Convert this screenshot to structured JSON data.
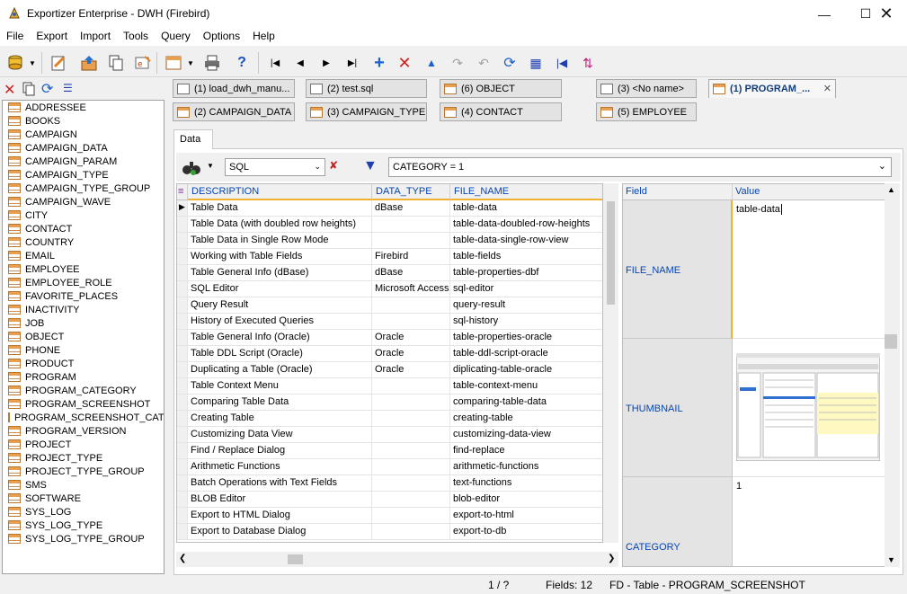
{
  "window": {
    "title": "Exportizer Enterprise - DWH (Firebird)"
  },
  "menu": [
    "File",
    "Export",
    "Import",
    "Tools",
    "Query",
    "Options",
    "Help"
  ],
  "tables": [
    "ADDRESSEE",
    "BOOKS",
    "CAMPAIGN",
    "CAMPAIGN_DATA",
    "CAMPAIGN_PARAM",
    "CAMPAIGN_TYPE",
    "CAMPAIGN_TYPE_GROUP",
    "CAMPAIGN_WAVE",
    "CITY",
    "CONTACT",
    "COUNTRY",
    "EMAIL",
    "EMPLOYEE",
    "EMPLOYEE_ROLE",
    "FAVORITE_PLACES",
    "INACTIVITY",
    "JOB",
    "OBJECT",
    "PHONE",
    "PRODUCT",
    "PROGRAM",
    "PROGRAM_CATEGORY",
    "PROGRAM_SCREENSHOT",
    "PROGRAM_SCREENSHOT_CATE",
    "PROGRAM_VERSION",
    "PROJECT",
    "PROJECT_TYPE",
    "PROJECT_TYPE_GROUP",
    "SMS",
    "SOFTWARE",
    "SYS_LOG",
    "SYS_LOG_TYPE",
    "SYS_LOG_TYPE_GROUP"
  ],
  "tabs": {
    "row1": [
      {
        "label": "(1) load_dwh_manu...",
        "icon": "sql"
      },
      {
        "label": "(2) test.sql",
        "icon": "sql"
      },
      {
        "label": "(6) OBJECT",
        "icon": "table"
      },
      {
        "label": "(3) <No name>",
        "icon": "sql"
      },
      {
        "label": "(1) PROGRAM_...",
        "icon": "table",
        "active": true
      }
    ],
    "row2": [
      {
        "label": "(2) CAMPAIGN_DATA",
        "icon": "table"
      },
      {
        "label": "(3) CAMPAIGN_TYPE",
        "icon": "table"
      },
      {
        "label": "(4) CONTACT",
        "icon": "table"
      },
      {
        "label": "(5) EMPLOYEE",
        "icon": "table"
      }
    ]
  },
  "data_tab": "Data",
  "filter": {
    "mode": "SQL",
    "expression": "CATEGORY = 1"
  },
  "grid": {
    "columns": [
      "DESCRIPTION",
      "DATA_TYPE",
      "FILE_NAME"
    ],
    "rows": [
      [
        "Table Data",
        "dBase",
        "table-data"
      ],
      [
        "Table Data (with doubled row heights)",
        "",
        "table-data-doubled-row-heights"
      ],
      [
        "Table Data in Single Row Mode",
        "",
        "table-data-single-row-view"
      ],
      [
        "Working with Table Fields",
        "Firebird",
        "table-fields"
      ],
      [
        "Table General Info (dBase)",
        "dBase",
        "table-properties-dbf"
      ],
      [
        "SQL Editor",
        "Microsoft Access",
        "sql-editor"
      ],
      [
        "Query Result",
        "",
        "query-result"
      ],
      [
        "History of Executed Queries",
        "",
        "sql-history"
      ],
      [
        "Table General Info (Oracle)",
        "Oracle",
        "table-properties-oracle"
      ],
      [
        "Table DDL Script (Oracle)",
        "Oracle",
        "table-ddl-script-oracle"
      ],
      [
        "Duplicating a Table (Oracle)",
        "Oracle",
        "diplicating-table-oracle"
      ],
      [
        "Table Context Menu",
        "",
        "table-context-menu"
      ],
      [
        "Comparing Table Data",
        "",
        "comparing-table-data"
      ],
      [
        "Creating Table",
        "",
        "creating-table"
      ],
      [
        "Customizing Data View",
        "",
        "customizing-data-view"
      ],
      [
        "Find / Replace Dialog",
        "",
        "find-replace"
      ],
      [
        "Arithmetic Functions",
        "",
        "arithmetic-functions"
      ],
      [
        "Batch Operations with Text Fields",
        "",
        "text-functions"
      ],
      [
        "BLOB Editor",
        "",
        "blob-editor"
      ],
      [
        "Export to HTML Dialog",
        "",
        "export-to-html"
      ],
      [
        "Export to Database Dialog",
        "",
        "export-to-db"
      ]
    ]
  },
  "record": {
    "headers": {
      "field": "Field",
      "value": "Value"
    },
    "fields": [
      {
        "name": "FILE_NAME",
        "value": "table-data"
      },
      {
        "name": "THUMBNAIL",
        "value": ""
      },
      {
        "name": "CATEGORY",
        "value": "1"
      }
    ]
  },
  "status": {
    "position": "1 / ?",
    "fields": "Fields: 12",
    "info": "FD - Table - PROGRAM_SCREENSHOT"
  },
  "colors": {
    "accent": "#0645b4",
    "sort_marker": "#f0b030",
    "title_bar": "#ffffff"
  }
}
